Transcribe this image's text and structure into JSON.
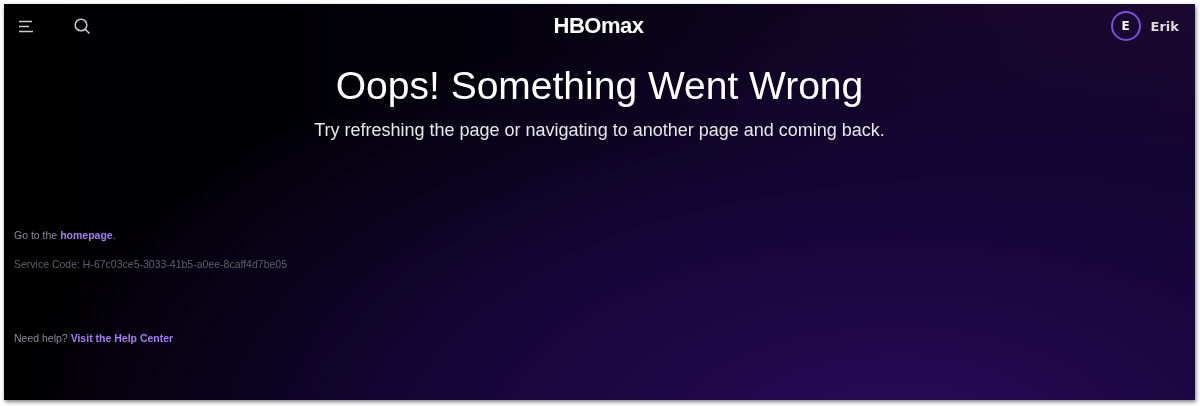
{
  "header": {
    "logo": "HBOmax",
    "profile": {
      "initial": "E",
      "name": "Erik"
    }
  },
  "error": {
    "title": "Oops! Something Went Wrong",
    "message": "Try refreshing the page or navigating to another page and coming back."
  },
  "homepage_line": {
    "before": "Go to the ",
    "link": "homepage",
    "after": "."
  },
  "service_code": "Service Code: H-67c03ce5-3033-41b5-a0ee-8caff4d7be05",
  "help": {
    "prompt": "Need help?",
    "link": "Visit the Help Center"
  }
}
